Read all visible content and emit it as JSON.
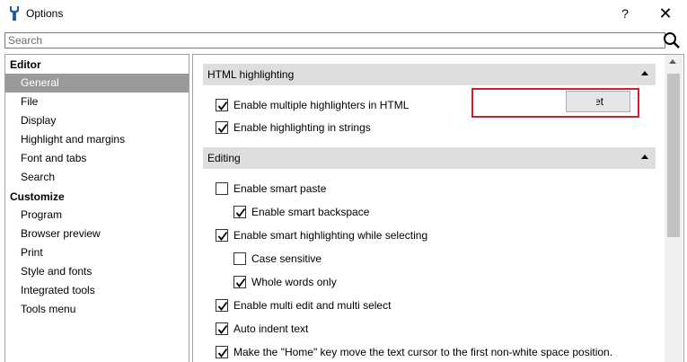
{
  "window": {
    "title": "Options",
    "help_label": "?",
    "close_label": "✕"
  },
  "search": {
    "placeholder": "Search",
    "value": ""
  },
  "sidebar": {
    "groups": [
      {
        "label": "Editor",
        "items": [
          "General",
          "File",
          "Display",
          "Highlight and margins",
          "Font and tabs",
          "Search"
        ]
      },
      {
        "label": "Customize",
        "items": [
          "Program",
          "Browser preview",
          "Print",
          "Style and fonts",
          "Integrated tools",
          "Tools menu"
        ]
      }
    ],
    "selected": "General"
  },
  "sections": [
    {
      "title": "HTML highlighting",
      "options": [
        {
          "label": "Enable multiple highlighters in HTML",
          "checked": true
        },
        {
          "label": "Enable highlighting in strings",
          "checked": true
        }
      ]
    },
    {
      "title": "Editing",
      "options": [
        {
          "label": "Enable smart paste",
          "checked": false
        },
        {
          "label": "Enable smart backspace",
          "checked": true
        },
        {
          "label": "Enable smart highlighting while selecting",
          "checked": true
        },
        {
          "label": "Case sensitive",
          "checked": false
        },
        {
          "label": "Whole words only",
          "checked": true
        },
        {
          "label": "Enable multi edit and multi select",
          "checked": true
        },
        {
          "label": "Auto indent text",
          "checked": true
        },
        {
          "label": "Make the \"Home\" key move the text cursor to the first non-white space position.",
          "checked": true
        }
      ]
    }
  ],
  "reset_button": {
    "label": "et"
  },
  "colors": {
    "selected_item_bg": "#9a9a9a",
    "section_header_bg": "#dedede",
    "highlight_border": "#d0202a"
  }
}
